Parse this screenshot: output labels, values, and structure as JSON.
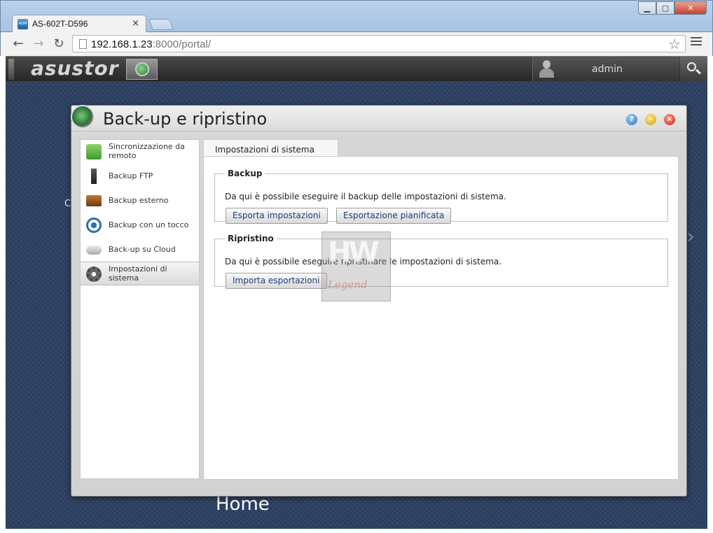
{
  "browser": {
    "tab_title": "AS-602T-D596",
    "favicon_text": "ADM",
    "tab_close": "×",
    "url_host": "192.168.1.23",
    "url_rest": ":8000/portal/",
    "window_controls": {
      "minimize": "▁",
      "maximize": "▢",
      "close": "✕"
    }
  },
  "portal": {
    "logo": "asustor",
    "username": "admin",
    "desktop_fragment": "C",
    "desktop_label": "Home"
  },
  "app_window": {
    "title": "Back-up e ripristino",
    "controls": {
      "help": "?",
      "minimize": "–",
      "close": "×"
    },
    "sidebar": {
      "items": [
        {
          "label": "Sincronizzazione da remoto",
          "icon": "sync-icon",
          "active": false
        },
        {
          "label": "Backup FTP",
          "icon": "ftp-icon",
          "active": false
        },
        {
          "label": "Backup esterno",
          "icon": "external-drive-icon",
          "active": false
        },
        {
          "label": "Backup con un tocco",
          "icon": "one-touch-icon",
          "active": false
        },
        {
          "label": "Back-up su Cloud",
          "icon": "cloud-icon",
          "active": false
        },
        {
          "label": "Impostazioni di sistema",
          "icon": "gear-icon",
          "active": true
        }
      ]
    },
    "content": {
      "tab_label": "Impostazioni di sistema",
      "backup": {
        "legend": "Backup",
        "text": "Da qui è possibile eseguire il backup delle impostazioni di sistema.",
        "export_button": "Esporta impostazioni",
        "scheduled_button": "Esportazione pianificata"
      },
      "restore": {
        "legend": "Ripristino",
        "text": "Da qui è possibile eseguire ripristinare le impostazioni di sistema.",
        "import_button": "Importa esportazioni"
      }
    }
  },
  "watermark": {
    "top": "HW",
    "bottom": "Legend"
  }
}
